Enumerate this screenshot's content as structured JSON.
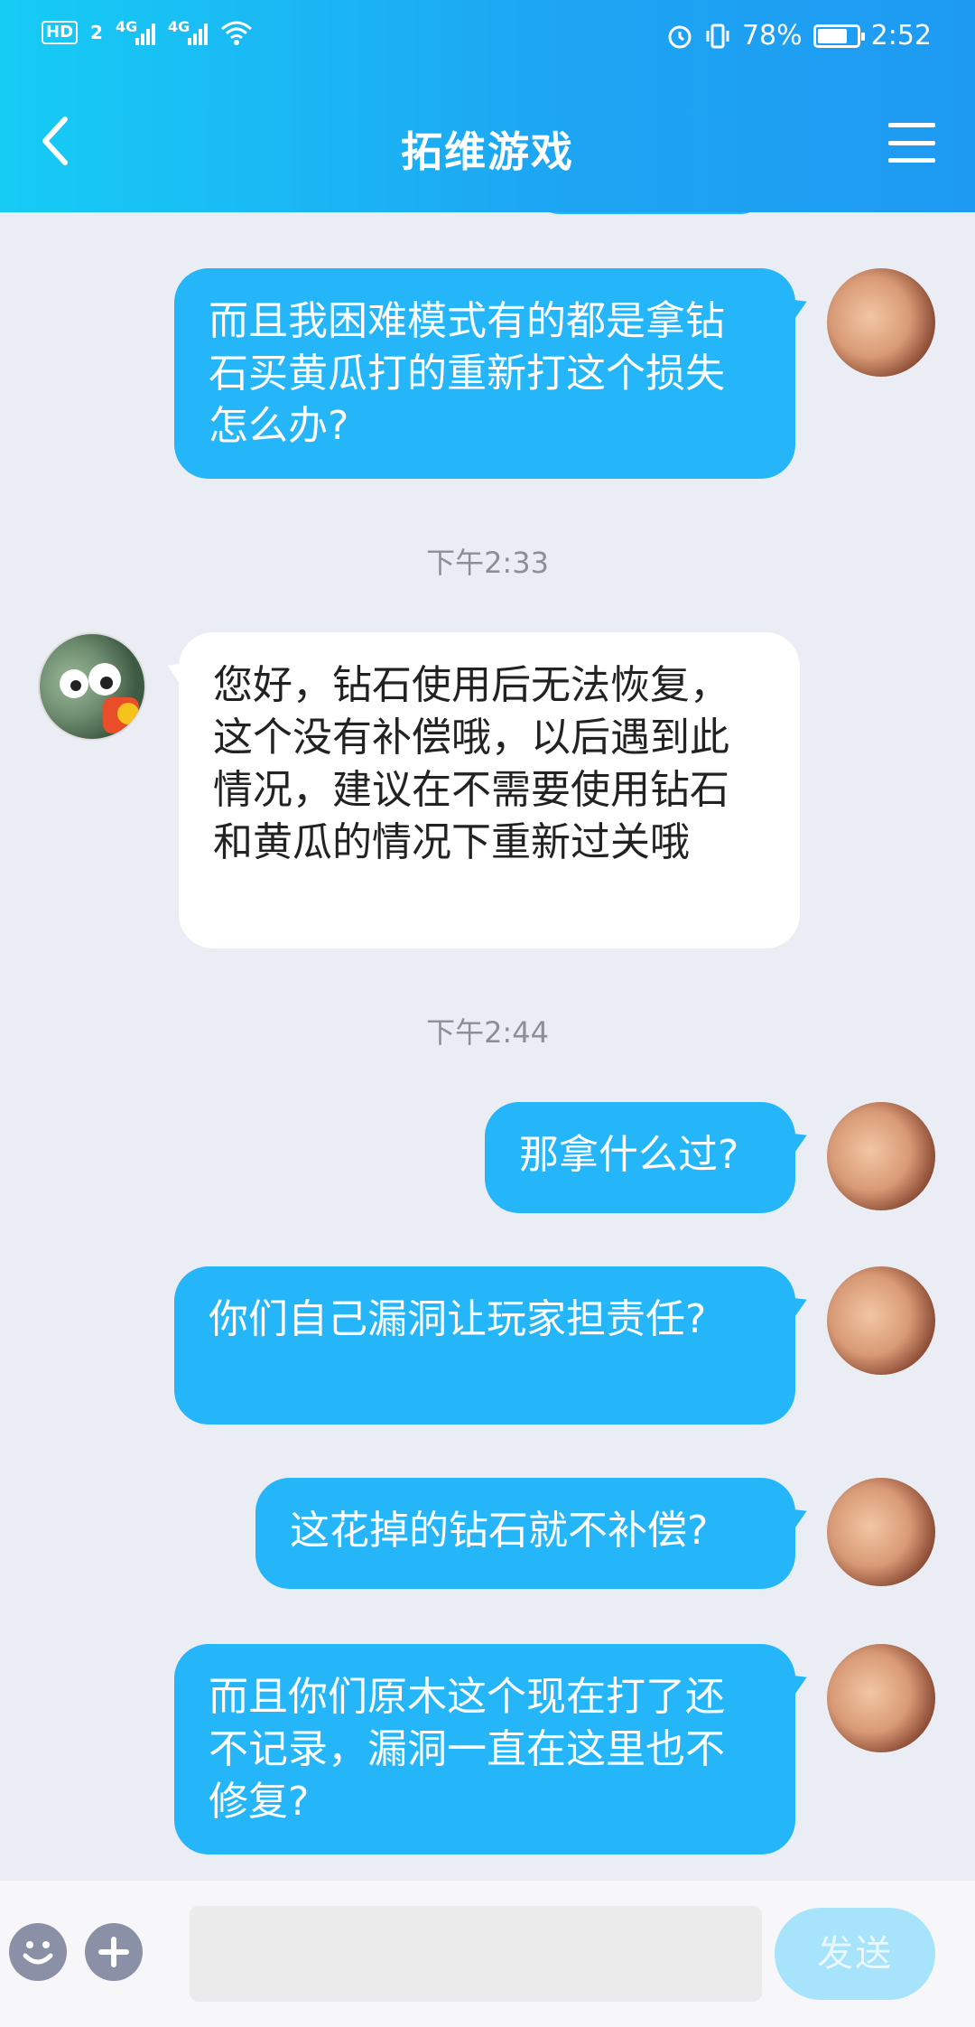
{
  "status_bar": {
    "hd_label": "HD",
    "sim": "2",
    "signal1": "4G",
    "signal2": "4G",
    "battery": "78%",
    "time": "2:52",
    "battery_level": 0.78
  },
  "header": {
    "title": "拓维游戏"
  },
  "messages": [
    {
      "dir": "out",
      "text": "而且我困难模式有的都是拿钻石买黄瓜打的重新打这个损失怎么办?"
    },
    {
      "dir": "time",
      "text": "下午2:33"
    },
    {
      "dir": "in",
      "text": "您好，钻石使用后无法恢复，这个没有补偿哦，以后遇到此情况，建议在不需要使用钻石和黄瓜的情况下重新过关哦"
    },
    {
      "dir": "time",
      "text": "下午2:44"
    },
    {
      "dir": "out",
      "text": "那拿什么过?"
    },
    {
      "dir": "out",
      "text": "你们自己漏洞让玩家担责任?"
    },
    {
      "dir": "out",
      "text": "这花掉的钻石就不补偿?"
    },
    {
      "dir": "out",
      "text": "而且你们原木这个现在打了还不记录，漏洞一直在这里也不修复?"
    }
  ],
  "input": {
    "send_label": "发送",
    "placeholder": ""
  }
}
